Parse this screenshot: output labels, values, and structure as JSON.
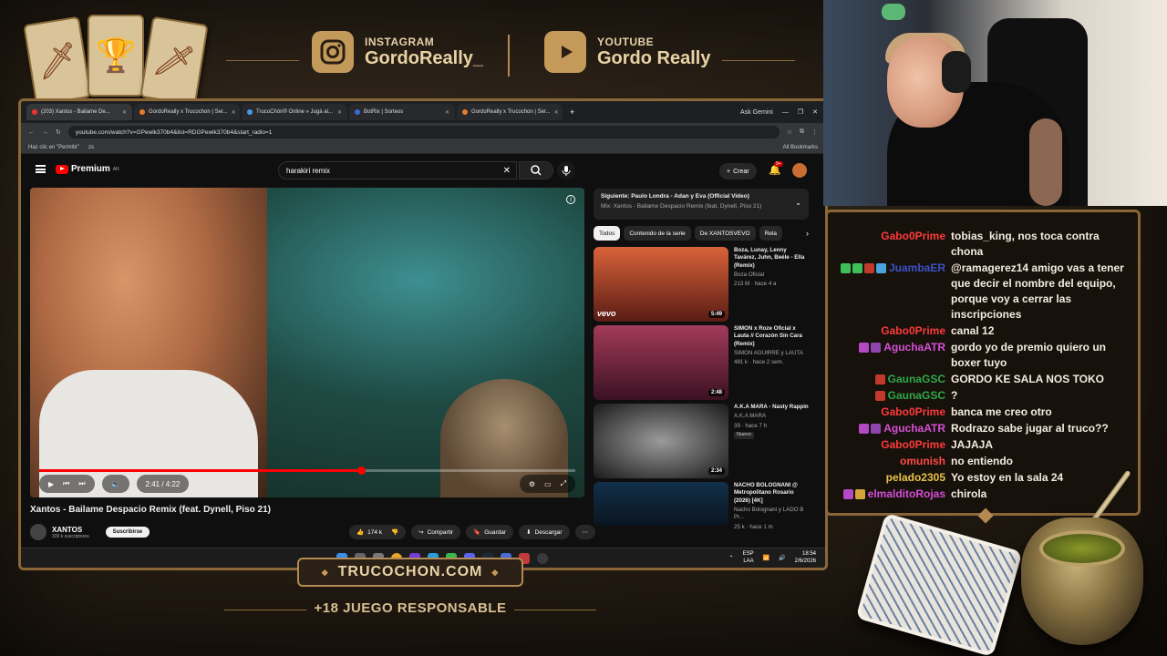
{
  "overlay": {
    "instagram": {
      "kicker": "INSTAGRAM",
      "handle": "GordoReally_"
    },
    "youtube": {
      "kicker": "YOUTUBE",
      "handle": "Gordo Really"
    },
    "site_banner": "TRUCOCHON.COM",
    "responsible": "+18 JUEGO RESPONSABLE",
    "colors": {
      "gold": "#b48a52",
      "dark": "#1f1a14"
    }
  },
  "browser": {
    "tabs": [
      {
        "title": "(203) Xantos - Bailame De...",
        "active": true
      },
      {
        "title": "GordoReally x Trucochon | Ser...",
        "active": false
      },
      {
        "title": "TrucoChón® Online » Jugá al...",
        "active": false
      },
      {
        "title": "BotRix | Sorteos",
        "active": false
      },
      {
        "title": "GordoReally x Trucochon | Ser...",
        "active": false
      }
    ],
    "new_tab": "+",
    "ask_gemini": "Ask Gemini",
    "url": "youtube.com/watch?v=GPewlk370b4&list=RDGPewlk370b4&start_radio=1",
    "bookmarks": {
      "left": "Haz clic en \"Permitir\"",
      "pin": "zs",
      "right": "All Bookmarks"
    }
  },
  "youtube": {
    "logo": "Premium",
    "logo_sup": "AR",
    "search_query": "harakiri remix",
    "create_label": "Crear",
    "notif_count": "9+",
    "video": {
      "title": "Xantos - Bailame Despacio Remix (feat. Dynell, Piso 21)",
      "time": "2:41 / 4:22",
      "progress": 0.6,
      "channel": "XANTOS",
      "subscribers": "339 k suscriptores",
      "subscribe": "Suscribirse",
      "likes": "174 k",
      "share": "Compartir",
      "save": "Guardar",
      "download": "Descargar"
    },
    "up_next": {
      "title": "Siguiente: Paulo Londra - Adan y Eva (Official Video)",
      "subtitle": "Mix: Xantos - Bailame Despacio Remix (feat. Dynell, Piso 21)"
    },
    "chips": [
      "Todos",
      "Contenido de la serie",
      "De XANTOSVEVO",
      "Rela"
    ],
    "recommended": [
      {
        "title": "Boza, Lunay, Lenny Tavárez, Juhn, Beéle - Ella (Remix)",
        "channel": "Boza Oficial",
        "stats": "213 M · hace 4 a",
        "duration": "5:49",
        "badge": "",
        "thumb": "#b04c2c"
      },
      {
        "title": "SIMON x Roze Oficial x Lauta // Corazón Sin Cara (Remix)",
        "channel": "SIMON AGUIRRE y LAUTA",
        "stats": "481 k · hace 2 sem.",
        "duration": "2:48",
        "badge": "",
        "thumb": "#7a2240"
      },
      {
        "title": "A.K.A MARA - Nasty Rappin",
        "channel": "A.K.A MARA",
        "stats": "39 · hace 7 h",
        "duration": "2:34",
        "badge": "Nuevo",
        "thumb": "#4a4a4a"
      },
      {
        "title": "NACHO BOLOGNANI @ Metropolitano Rosario (2026) [4K]",
        "channel": "Nacho Bolognani y LADO B Pr...",
        "stats": "25 k · hace 1 m",
        "duration": "",
        "badge": "",
        "thumb": "#18324a"
      }
    ]
  },
  "taskbar": {
    "lang": "ESP",
    "lang2": "LAA",
    "time": "18:54",
    "date": "2/6/2026"
  },
  "chat": [
    {
      "user": "Gabo0Prime",
      "color": "#ff3b3b",
      "badges": [],
      "text": "tobias_king, nos toca contra chona"
    },
    {
      "user": "JuambaER",
      "color": "#3b52c8",
      "badges": [
        "#3fbf5a",
        "#3fbf5a",
        "#c0392b",
        "#4aa3df"
      ],
      "text": "@ramagerez14 amigo vas a tener que decir el nombre del equipo, porque voy a cerrar las inscripciones"
    },
    {
      "user": "Gabo0Prime",
      "color": "#ff3b3b",
      "badges": [],
      "text": "canal 12"
    },
    {
      "user": "AguchaATR",
      "color": "#d64fd6",
      "badges": [
        "#b548c6",
        "#8e44ad"
      ],
      "text": "gordo yo de premio quiero un boxer tuyo"
    },
    {
      "user": "GaunaGSC",
      "color": "#2ea84a",
      "badges": [
        "#c0392b"
      ],
      "text": "GORDO KE SALA NOS TOKO"
    },
    {
      "user": "GaunaGSC",
      "color": "#2ea84a",
      "badges": [
        "#c0392b"
      ],
      "text": "?"
    },
    {
      "user": "Gabo0Prime",
      "color": "#ff3b3b",
      "badges": [],
      "text": "banca me creo otro"
    },
    {
      "user": "AguchaATR",
      "color": "#d64fd6",
      "badges": [
        "#b548c6",
        "#8e44ad"
      ],
      "text": "Rodrazo sabe jugar al truco??"
    },
    {
      "user": "Gabo0Prime",
      "color": "#ff3b3b",
      "badges": [],
      "text": "JAJAJA"
    },
    {
      "user": "omunish",
      "color": "#ff4a4a",
      "badges": [],
      "text": "no entiendo"
    },
    {
      "user": "pelado2305",
      "color": "#e8c24a",
      "badges": [],
      "text": "Yo estoy en la sala 24"
    },
    {
      "user": "elmalditoRojas",
      "color": "#d64fd6",
      "badges": [
        "#b548c6",
        "#d4a63a"
      ],
      "text": "chirola"
    }
  ]
}
